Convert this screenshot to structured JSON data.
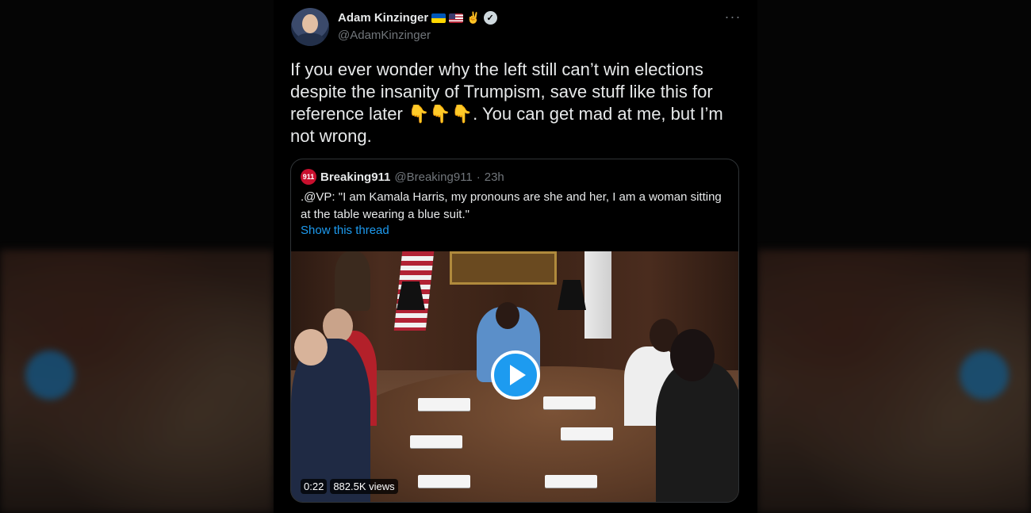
{
  "tweet": {
    "display_name": "Adam Kinzinger",
    "name_emoji": "✌️",
    "handle": "@AdamKinzinger",
    "verified_mark": "✓",
    "more_label": "···",
    "text_part1": "If you ever wonder why the left still can’t win elections despite the insanity of Trumpism, save stuff like this for reference later ",
    "pointing_emoji": "👇👇👇",
    "text_part2": ". You can get mad at me, but I’m not wrong."
  },
  "quote": {
    "avatar_text": "911",
    "name": "Breaking911",
    "handle": "@Breaking911",
    "separator": "·",
    "time": "23h",
    "text": ".@VP: \"I am Kamala Harris, my pronouns are she and her, I am a woman sitting at the table wearing a blue suit.\"",
    "show_thread": "Show this thread",
    "video": {
      "duration": "0:22",
      "views": "882.5K views"
    }
  },
  "colors": {
    "accent": "#1d9bf0",
    "background": "#000000",
    "text_primary": "#e7e9ea",
    "text_secondary": "#71767b"
  }
}
